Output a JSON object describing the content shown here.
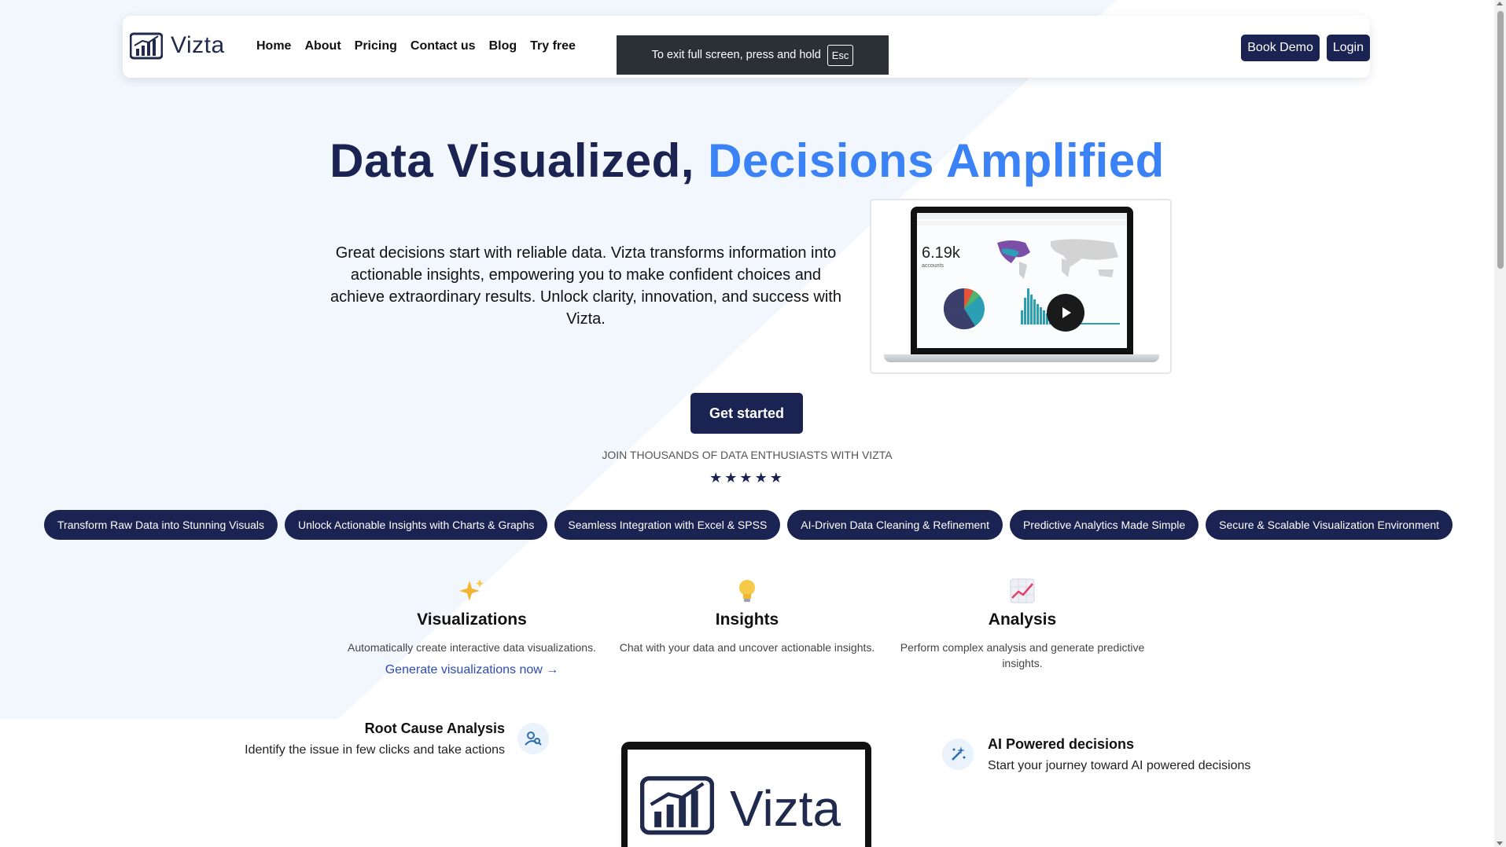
{
  "brand": {
    "name": "Vizta"
  },
  "nav": {
    "links": [
      "Home",
      "About",
      "Pricing",
      "Contact us",
      "Blog",
      "Try free"
    ],
    "book_demo": "Book Demo",
    "login": "Login"
  },
  "fullscreen_toast": {
    "text": "To exit full screen, press and hold",
    "key": "Esc"
  },
  "hero": {
    "title_dark": "Data Visualized,",
    "title_accent": "Decisions Amplified",
    "description": "Great decisions start with reliable data. Vizta transforms information into actionable insights, empowering you to make confident choices and achieve extraordinary results. Unlock clarity, innovation, and success with Vizta.",
    "cta": "Get started",
    "join_text": "JOIN THOUSANDS OF DATA ENTHUSIASTS WITH VIZTA",
    "stars": "★★★★★",
    "rating": 5
  },
  "video_preview": {
    "metric_value": "6.19k",
    "metric_label": "accounts"
  },
  "pills": [
    "Transform Raw Data into Stunning Visuals",
    "Unlock Actionable Insights with Charts & Graphs",
    "Seamless Integration with Excel & SPSS",
    "AI-Driven Data Cleaning & Refinement",
    "Predictive Analytics Made Simple",
    "Secure & Scalable Visualization Environment"
  ],
  "features": [
    {
      "icon": "sparkles-icon",
      "title": "Visualizations",
      "desc": "Automatically create interactive data visualizations.",
      "link": "Generate visualizations now →"
    },
    {
      "icon": "lightbulb-icon",
      "title": "Insights",
      "desc": "Chat with your data and uncover actionable insights."
    },
    {
      "icon": "chart-trend-icon",
      "title": "Analysis",
      "desc": "Perform complex analysis and generate predictive insights."
    }
  ],
  "root_cause": {
    "title": "Root Cause Analysis",
    "desc": "Identify the issue in few clicks and take actions"
  },
  "ai_decisions": {
    "title": "AI Powered decisions",
    "desc": "Start your journey toward AI powered decisions"
  },
  "colors": {
    "primary": "#1a2352",
    "accent": "#3b82f6",
    "link": "#2d4bb3",
    "tint": "#f1f7fc"
  }
}
